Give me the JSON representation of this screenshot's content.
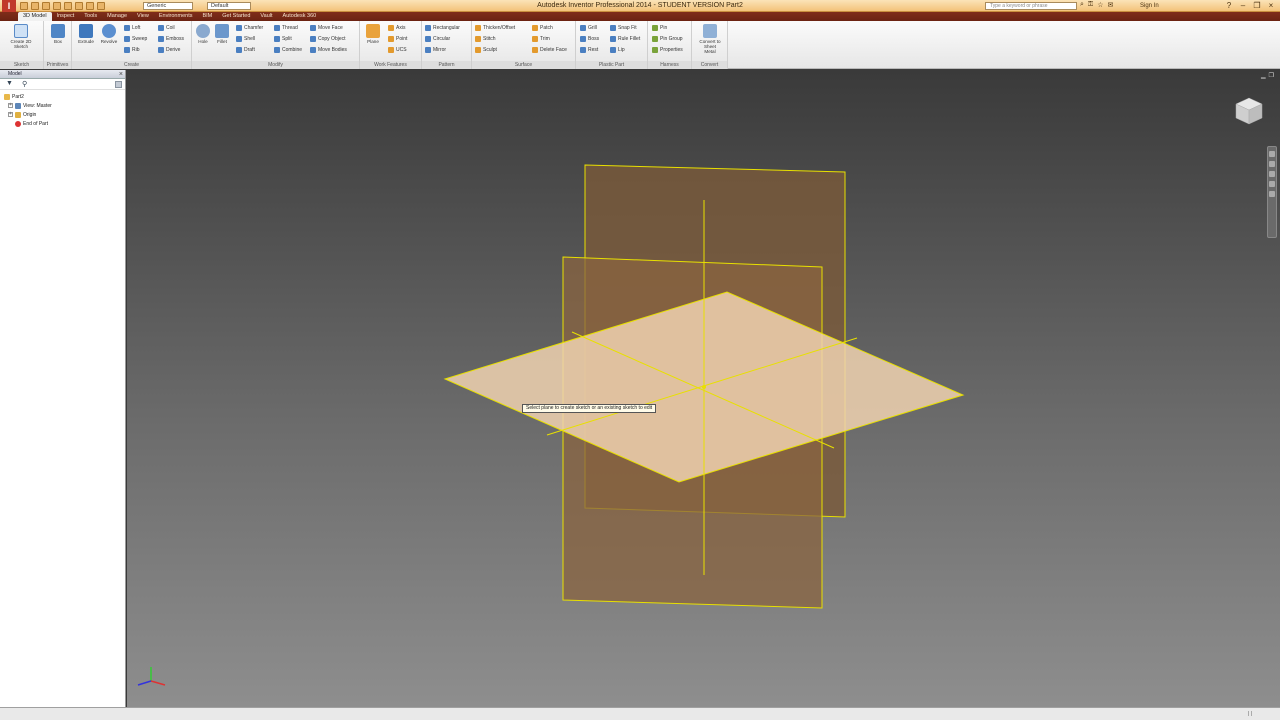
{
  "titlebar": {
    "app_logo": "I",
    "title": "Autodesk Inventor Professional 2014 - STUDENT VERSION    Part2",
    "material_dropdown": "Generic",
    "appearance_dropdown": "Default",
    "search_placeholder": "Type a keyword or phrase",
    "signin": "Sign In"
  },
  "tabs": [
    {
      "label": "3D Model",
      "active": true
    },
    {
      "label": "Inspect"
    },
    {
      "label": "Tools"
    },
    {
      "label": "Manage"
    },
    {
      "label": "View"
    },
    {
      "label": "Environments"
    },
    {
      "label": "BIM"
    },
    {
      "label": "Get Started"
    },
    {
      "label": "Vault"
    },
    {
      "label": "Autodesk 360"
    }
  ],
  "ribbon": {
    "sketch": {
      "label": "Sketch",
      "button": "Create 2D Sketch"
    },
    "primitives": {
      "label": "Primitives",
      "button": "Box"
    },
    "create": {
      "label": "Create",
      "big": [
        "Extrude",
        "Revolve"
      ],
      "small": [
        "Loft",
        "Sweep",
        "Rib",
        "Coil",
        "Emboss",
        "Derive"
      ]
    },
    "modify": {
      "label": "Modify",
      "big": [
        "Hole",
        "Fillet"
      ],
      "small": [
        "Chamfer",
        "Shell",
        "Draft",
        "Thread",
        "Split",
        "Combine",
        "Move Face",
        "Copy Object",
        "Move Bodies"
      ]
    },
    "work_features": {
      "label": "Work Features",
      "big": "Plane",
      "small": [
        "Axis",
        "Point",
        "UCS"
      ]
    },
    "pattern": {
      "label": "Pattern",
      "small": [
        "Rectangular",
        "Circular",
        "Mirror"
      ]
    },
    "surface": {
      "label": "Surface",
      "small": [
        "Thicken/Offset",
        "Stitch",
        "Sculpt",
        "Patch",
        "Trim",
        "Delete Face"
      ]
    },
    "plastic_part": {
      "label": "Plastic Part",
      "small": [
        "Grill",
        "Boss",
        "Rest",
        "Snap Fit",
        "Rule Fillet",
        "Lip"
      ]
    },
    "harness": {
      "label": "Harness",
      "small": [
        "Pin",
        "Pin Group",
        "Properties"
      ]
    },
    "convert": {
      "label": "Convert",
      "button": "Convert to Sheet Metal"
    }
  },
  "browser": {
    "title": "Model",
    "tree": [
      {
        "label": "Part2",
        "level": 0
      },
      {
        "label": "View: Master",
        "level": 1
      },
      {
        "label": "Origin",
        "level": 1
      },
      {
        "label": "End of Part",
        "level": 1
      }
    ]
  },
  "viewport": {
    "tooltip": "Select plane to create sketch or an existing sketch to edit"
  },
  "colors": {
    "plane_fill": "#f3d8b8",
    "plane_edge": "#e8e000",
    "title_bar": "#f3c27a",
    "tab_bar": "#7f2d1a"
  }
}
